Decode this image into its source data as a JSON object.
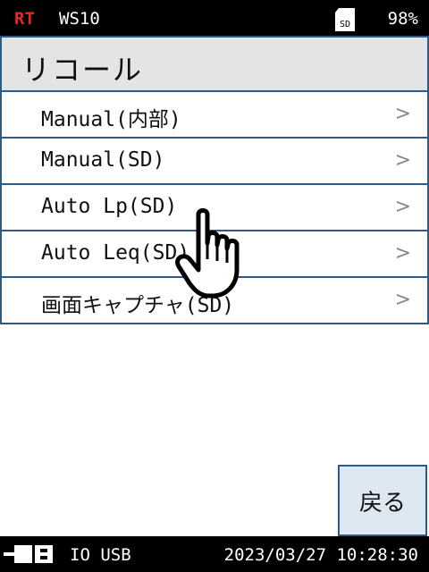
{
  "status": {
    "mode": "RT",
    "model": "WS10",
    "sd_label": "SD",
    "battery": "98%"
  },
  "title": "リコール",
  "menu": {
    "items": [
      {
        "label": "Manual(内部)",
        "chevron": ">"
      },
      {
        "label": "Manual(SD)",
        "chevron": ">"
      },
      {
        "label": "Auto Lp(SD)",
        "chevron": ">"
      },
      {
        "label": "Auto Leq(SD)",
        "chevron": ">"
      },
      {
        "label": "画面キャプチャ(SD)",
        "chevron": ">"
      }
    ]
  },
  "back_label": "戻る",
  "bottom": {
    "io": "IO USB",
    "datetime": "2023/03/27  10:28:30"
  },
  "colors": {
    "accent_border": "#2f5a86",
    "rt": "#e8262b",
    "title_bg": "#e4e4e4",
    "button_bg": "#dde8f3"
  },
  "icons": [
    "sd-card-icon",
    "connection-icon",
    "hand-pointer-icon",
    "chevron-right-icon"
  ]
}
